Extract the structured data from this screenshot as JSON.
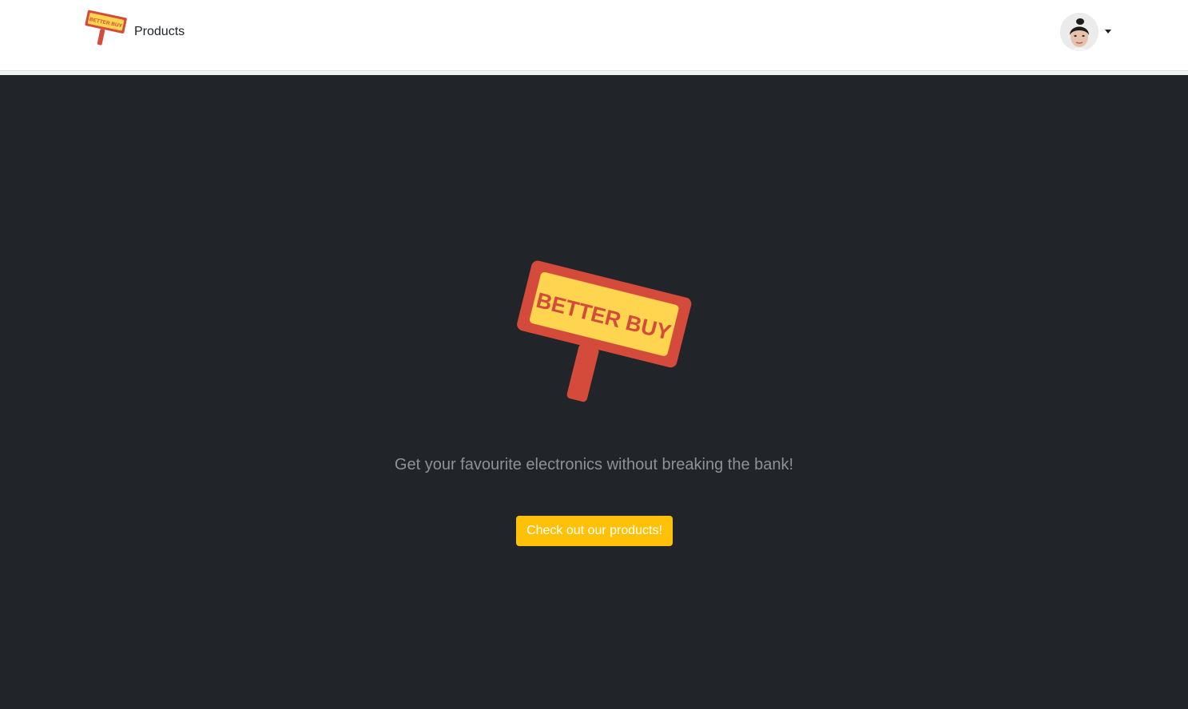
{
  "navbar": {
    "brand_logo_text": "BETTER BUY",
    "products_link": "Products"
  },
  "hero": {
    "logo_text": "BETTER BUY",
    "tagline": "Get your favourite electronics without breaking the bank!",
    "cta_label": "Check out our products!"
  },
  "colors": {
    "sign_red": "#d44a3b",
    "sign_yellow": "#ffd54f",
    "cta_yellow": "#ffc107",
    "background_dark": "#212428",
    "navbar_bg": "#ffffff"
  },
  "icons": {
    "user_menu": "caret-down-icon"
  }
}
